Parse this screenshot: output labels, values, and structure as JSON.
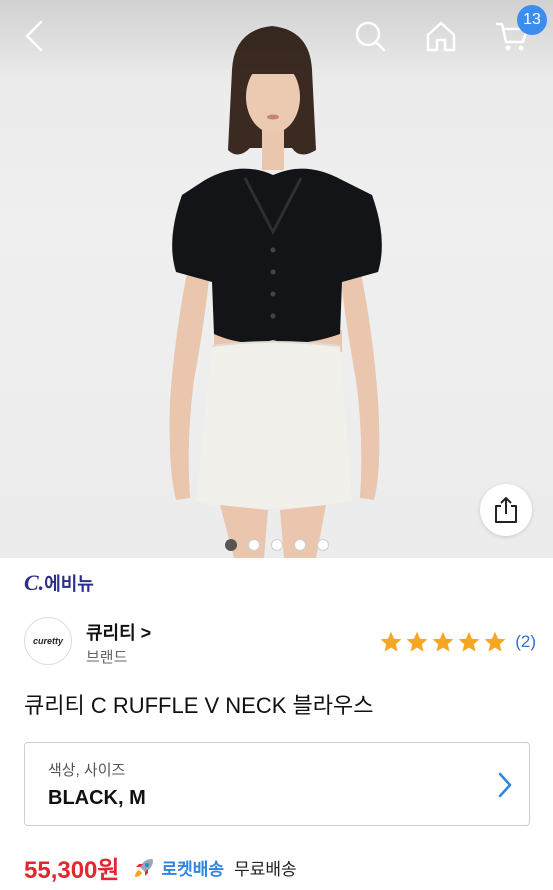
{
  "header": {
    "back_icon": "chevron-left-icon",
    "search_icon": "search-icon",
    "home_icon": "home-icon",
    "cart_icon": "cart-icon",
    "cart_count": "13"
  },
  "gallery": {
    "image": "model-wearing-black-ruffle-blouse-and-white-skirt",
    "dots_total": 5,
    "active_index": 0
  },
  "seller": {
    "mark": "C.",
    "name": "에비뉴"
  },
  "brand": {
    "logo_text": "curetty",
    "name": "큐리티 >",
    "subtitle": "브랜드",
    "rating_stars": 5,
    "rating_count": "(2)"
  },
  "product": {
    "title": "큐리티 C RUFFLE V NECK 블라우스"
  },
  "option": {
    "label": "색상, 사이즈",
    "value": "BLACK, M"
  },
  "price": {
    "amount": "55,300원",
    "rocket_label": "로켓배송",
    "shipping": "무료배송"
  },
  "colors": {
    "accent_blue": "#3b8ef0",
    "price_red": "#e3262f",
    "rating_star": "#f5a623",
    "seller_navy": "#2b2f8a"
  }
}
